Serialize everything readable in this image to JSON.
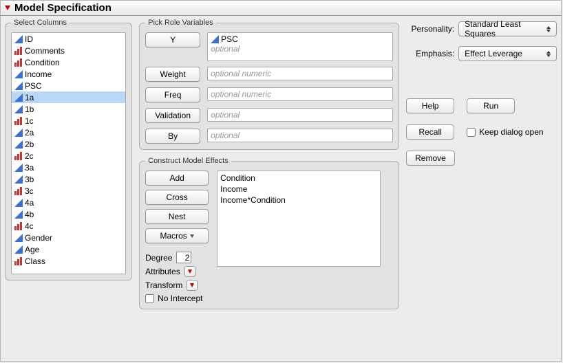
{
  "title": "Model Specification",
  "select_columns": {
    "legend": "Select Columns",
    "items": [
      {
        "name": "ID",
        "type": "cont"
      },
      {
        "name": "Comments",
        "type": "nom"
      },
      {
        "name": "Condition",
        "type": "nom"
      },
      {
        "name": "Income",
        "type": "cont"
      },
      {
        "name": "PSC",
        "type": "cont"
      },
      {
        "name": "1a",
        "type": "cont",
        "selected": true
      },
      {
        "name": "1b",
        "type": "cont"
      },
      {
        "name": "1c",
        "type": "nom"
      },
      {
        "name": "2a",
        "type": "cont"
      },
      {
        "name": "2b",
        "type": "cont"
      },
      {
        "name": "2c",
        "type": "nom"
      },
      {
        "name": "3a",
        "type": "cont"
      },
      {
        "name": "3b",
        "type": "cont"
      },
      {
        "name": "3c",
        "type": "nom"
      },
      {
        "name": "4a",
        "type": "cont"
      },
      {
        "name": "4b",
        "type": "cont"
      },
      {
        "name": "4c",
        "type": "nom"
      },
      {
        "name": "Gender",
        "type": "cont"
      },
      {
        "name": "Age",
        "type": "cont"
      },
      {
        "name": "Class",
        "type": "nom"
      }
    ]
  },
  "roles": {
    "legend": "Pick Role Variables",
    "y": {
      "label": "Y",
      "value": "PSC",
      "value_type": "cont",
      "hint": "optional"
    },
    "weight": {
      "label": "Weight",
      "hint": "optional numeric"
    },
    "freq": {
      "label": "Freq",
      "hint": "optional numeric"
    },
    "validation": {
      "label": "Validation",
      "hint": "optional"
    },
    "by": {
      "label": "By",
      "hint": "optional"
    }
  },
  "cme": {
    "legend": "Construct Model Effects",
    "buttons": {
      "add": "Add",
      "cross": "Cross",
      "nest": "Nest",
      "macros": "Macros"
    },
    "effects": [
      "Condition",
      "Income",
      "Income*Condition"
    ],
    "degree": {
      "label": "Degree",
      "value": "2"
    },
    "attributes_label": "Attributes",
    "transform_label": "Transform",
    "no_intercept_label": "No Intercept"
  },
  "right": {
    "personality": {
      "label": "Personality:",
      "value": "Standard Least Squares"
    },
    "emphasis": {
      "label": "Emphasis:",
      "value": "Effect Leverage"
    },
    "help": "Help",
    "run": "Run",
    "recall": "Recall",
    "remove": "Remove",
    "keep_open": "Keep dialog open"
  },
  "icons": {
    "continuous": "continuous-icon",
    "nominal": "nominal-icon"
  }
}
